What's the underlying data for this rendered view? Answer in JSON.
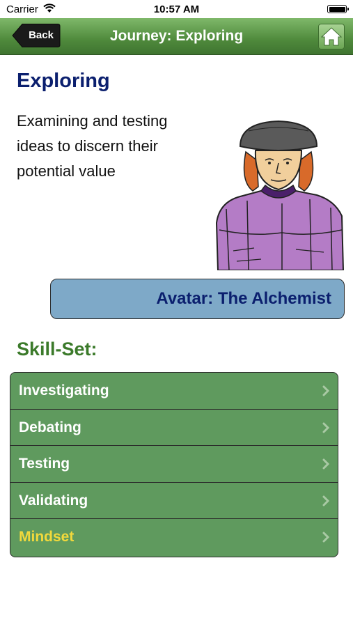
{
  "status_bar": {
    "carrier": "Carrier",
    "time": "10:57 AM"
  },
  "navbar": {
    "back_label": "Back",
    "title": "Journey: Exploring",
    "home_icon": "home-icon"
  },
  "page": {
    "title": "Exploring",
    "description": "Examining and testing ideas to discern their potential value",
    "avatar_label": "Avatar: The Alchemist"
  },
  "skills": {
    "title": "Skill-Set:",
    "items": [
      {
        "label": "Investigating"
      },
      {
        "label": "Debating"
      },
      {
        "label": "Testing"
      },
      {
        "label": "Validating"
      },
      {
        "label": "Mindset"
      }
    ]
  },
  "colors": {
    "nav_green": "#4f8a3c",
    "title_navy": "#0b1f6e",
    "section_green": "#3b7a2a",
    "banner_blue": "#7ea9c8",
    "row_green": "#5f9a5e",
    "mindset_yellow": "#f1d93c"
  }
}
